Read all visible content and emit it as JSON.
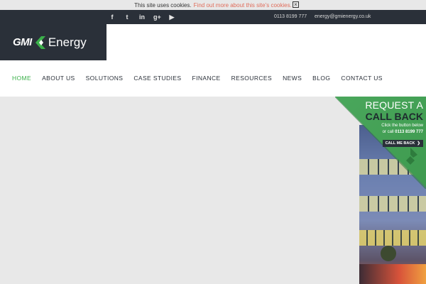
{
  "cookie_bar": {
    "text": "This site uses cookies.",
    "link": "Find out more about this site’s cookies.",
    "close_icon": "close-icon"
  },
  "topbar": {
    "social_icons": [
      "facebook-icon",
      "twitter-icon",
      "linkedin-icon",
      "google-plus-icon",
      "youtube-icon"
    ],
    "social_glyphs": [
      "f",
      "t",
      "in",
      "g+",
      "▶"
    ],
    "phone": "0113 8199 777",
    "email": "energy@gmienergy.co.uk"
  },
  "logo": {
    "gmi": "GMI",
    "energy": "Energy"
  },
  "nav": {
    "items": [
      {
        "label": "HOME",
        "active": true
      },
      {
        "label": "ABOUT US"
      },
      {
        "label": "SOLUTIONS"
      },
      {
        "label": "CASE STUDIES"
      },
      {
        "label": "FINANCE"
      },
      {
        "label": "RESOURCES"
      },
      {
        "label": "NEWS"
      },
      {
        "label": "BLOG"
      },
      {
        "label": "CONTACT US"
      }
    ]
  },
  "promo": {
    "request": "REQUEST A",
    "callback": "CALL BACK",
    "line1": "Click the button below",
    "line2_prefix": "or call",
    "line2_number": "0113 8199 777",
    "button": "CALL ME BACK",
    "button_icon": "chevron-right-icon"
  },
  "colors": {
    "dark": "#2a3039",
    "accent_green": "#3bb04a",
    "link_red": "#e06c5a"
  }
}
